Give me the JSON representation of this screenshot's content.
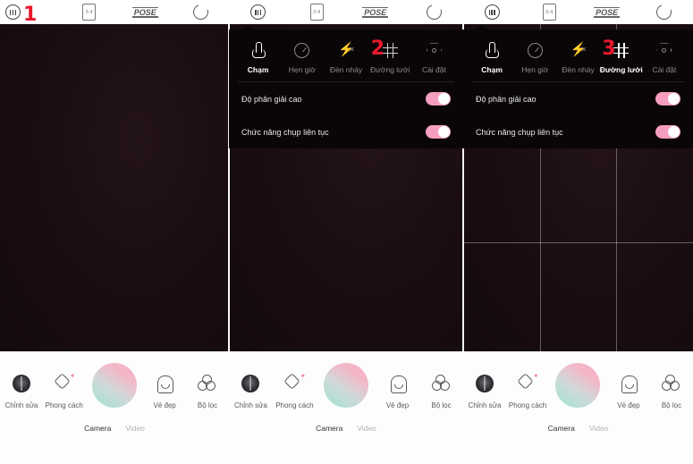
{
  "app": {
    "title": "Camera"
  },
  "topbar": {
    "icons": [
      {
        "name": "more-options-icon",
        "label": "more"
      },
      {
        "name": "aspect-ratio-icon",
        "label": "3:4"
      },
      {
        "name": "pose-icon",
        "label": "POSE"
      },
      {
        "name": "flip-camera-icon",
        "label": "flip"
      }
    ]
  },
  "markers": {
    "step1": "1",
    "step2": "2",
    "step3": "3"
  },
  "dropdown": {
    "items": [
      {
        "icon": "touch-shutter-icon",
        "label": "Chạm"
      },
      {
        "icon": "timer-icon",
        "label": "Hẹn giờ"
      },
      {
        "icon": "flash-off-icon",
        "label": "Đèn nháy"
      },
      {
        "icon": "grid-lines-icon",
        "label": "Đường lưới"
      },
      {
        "icon": "settings-icon",
        "label": "Cài đặt"
      }
    ],
    "rows": [
      {
        "label": "Độ phân giải cao",
        "toggle": "on"
      },
      {
        "label": "Chức năng chụp liên tục",
        "toggle": "on"
      }
    ]
  },
  "bottom": {
    "tools": [
      {
        "icon": "gallery-thumbnail-icon",
        "label": "Chỉnh sửa"
      },
      {
        "icon": "style-sparkle-icon",
        "label": "Phong cách"
      },
      {
        "icon": "beauty-face-icon",
        "label": "Vẻ đẹp"
      },
      {
        "icon": "filter-circles-icon",
        "label": "Bộ lọc"
      }
    ],
    "shutter": {
      "name": "shutter-button"
    },
    "modes": [
      {
        "label": "Camera",
        "active": true
      },
      {
        "label": "Video",
        "active": false
      }
    ]
  },
  "colors": {
    "accent_red": "#e8192c",
    "toggle_pink": "#f59ec0",
    "preview_dark": "#1b0d12",
    "dropdown_bg": "#0a0608"
  }
}
